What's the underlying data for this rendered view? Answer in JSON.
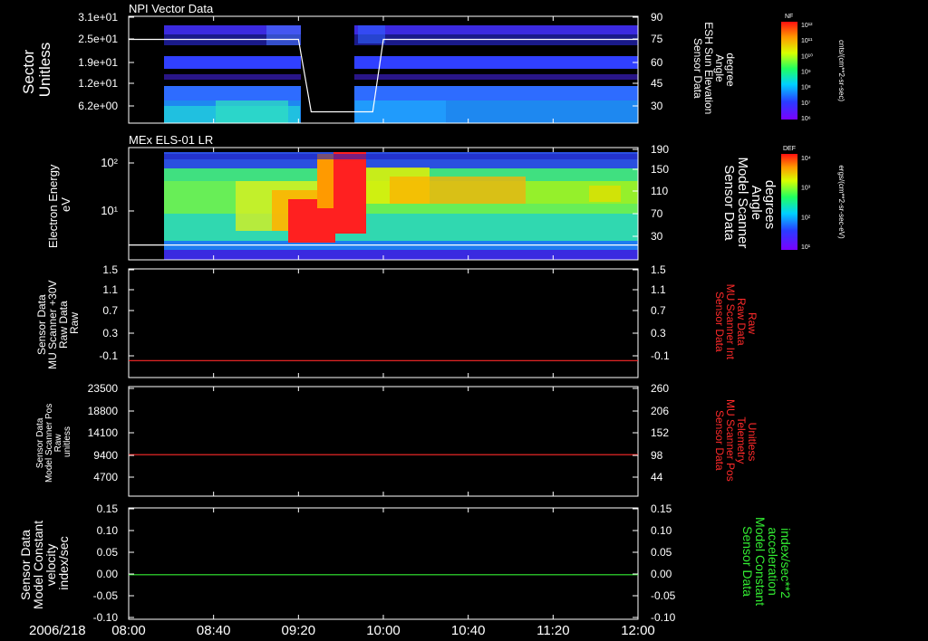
{
  "colors": {
    "white": "#ffffff",
    "red": "#ff2a2a",
    "green": "#33ee33",
    "background": "#000000"
  },
  "time_axis": {
    "date": "2006/218",
    "ticks": [
      "08:00",
      "08:40",
      "09:20",
      "10:00",
      "10:40",
      "11:20",
      "12:00"
    ],
    "range_minutes": [
      0,
      240
    ]
  },
  "chart_data": [
    {
      "id": "panel1",
      "type": "heatmap",
      "title": "NPI Vector Data",
      "ylabel": [
        "Sector",
        "Unitless"
      ],
      "yticks": [
        "3.1e+01",
        "2.5e+01",
        "1.9e+01",
        "1.2e+01",
        "6.2e+00"
      ],
      "ylabel2": [
        "Sensor Data",
        "ESH Sun Elevation",
        "Angle",
        "degree"
      ],
      "yticks2": [
        "90",
        "75",
        "60",
        "45",
        "30"
      ],
      "y2lim": [
        18,
        90
      ],
      "colorbar": {
        "label": "NF",
        "units": "cnts/(cm**2-sr-sec)",
        "ticks": [
          "10¹²",
          "10¹¹",
          "10¹⁰",
          "10⁹",
          "10⁸",
          "10⁷",
          "10⁶"
        ]
      },
      "data_gaps_minutes": [
        [
          0,
          20
        ],
        [
          86,
          115
        ]
      ],
      "overlay_line": {
        "axis": "right",
        "x": [
          0,
          80,
          86,
          102,
          115,
          120,
          240
        ],
        "y": [
          75,
          75,
          26,
          26,
          26,
          75,
          75
        ]
      }
    },
    {
      "id": "panel2",
      "type": "heatmap",
      "title": "MEx ELS-01 LR",
      "ylabel": [
        "Electron Energy",
        "eV"
      ],
      "yticks": [
        "10²",
        "10¹"
      ],
      "ylabel2": [
        "Sensor Data",
        "Model Scanner",
        "Angle",
        "degrees"
      ],
      "yticks2": [
        "190",
        "150",
        "110",
        "70",
        "30"
      ],
      "y2lim": [
        0,
        190
      ],
      "colorbar": {
        "label": "DEF",
        "units": "ergs/(cm**2-sr-sec-eV)",
        "ticks": [
          "10⁴",
          "10³",
          "10²",
          "10¹"
        ]
      },
      "data_gaps_minutes": [
        [
          0,
          20
        ]
      ],
      "overlay_line": {
        "axis": "right",
        "x": [
          0,
          20,
          240
        ],
        "y": [
          14,
          14,
          14
        ]
      }
    },
    {
      "id": "panel3",
      "type": "line",
      "ylabel": [
        "Sensor Data",
        "MU Scanner +30V",
        "Raw Data",
        "Raw"
      ],
      "yticks": [
        "1.5",
        "1.1",
        "0.7",
        "0.3",
        "-0.1"
      ],
      "ylim": [
        -0.3,
        1.5
      ],
      "ylabel2": [
        "Sensor Data",
        "MU Scanner Int",
        "Raw Data",
        "Raw"
      ],
      "yticks2": [
        "1.5",
        "1.1",
        "0.7",
        "0.3",
        "-0.1"
      ],
      "y2lim": [
        -0.3,
        1.5
      ],
      "series": [
        {
          "axis": "left",
          "x": [
            0,
            240
          ],
          "y": [
            -0.02,
            -0.02
          ],
          "color": "red"
        }
      ]
    },
    {
      "id": "panel4",
      "type": "line",
      "ylabel": [
        "Sensor Data",
        "Model Scanner Pos",
        "Raw",
        "unitless"
      ],
      "yticks": [
        "23500",
        "18800",
        "14100",
        "9400",
        "4700"
      ],
      "ylim": [
        0,
        23500
      ],
      "ylabel2": [
        "Sensor Data",
        "MU Scanner Pos",
        "Telemetry",
        "Unitless"
      ],
      "yticks2": [
        "260",
        "206",
        "152",
        "98",
        "44"
      ],
      "y2lim": [
        0,
        260
      ],
      "series": [
        {
          "axis": "left",
          "x": [
            0,
            240
          ],
          "y": [
            8900,
            8900
          ],
          "color": "red"
        }
      ]
    },
    {
      "id": "panel5",
      "type": "line",
      "ylabel": [
        "Sensor Data",
        "Model Constant",
        "velocity",
        "index/sec"
      ],
      "yticks": [
        "0.15",
        "0.10",
        "0.05",
        "0.00",
        "-0.05",
        "-0.10"
      ],
      "ylim": [
        -0.1,
        0.15
      ],
      "ylabel2": [
        "Sensor Data",
        "Model Constant",
        "acceleration",
        "index/sec**2"
      ],
      "yticks2": [
        "0.15",
        "0.10",
        "0.05",
        "0.00",
        "-0.05",
        "-0.10"
      ],
      "y2lim": [
        -0.1,
        0.15
      ],
      "series": [
        {
          "axis": "left",
          "x": [
            0,
            240
          ],
          "y": [
            0,
            0
          ],
          "color": "green"
        }
      ]
    }
  ]
}
